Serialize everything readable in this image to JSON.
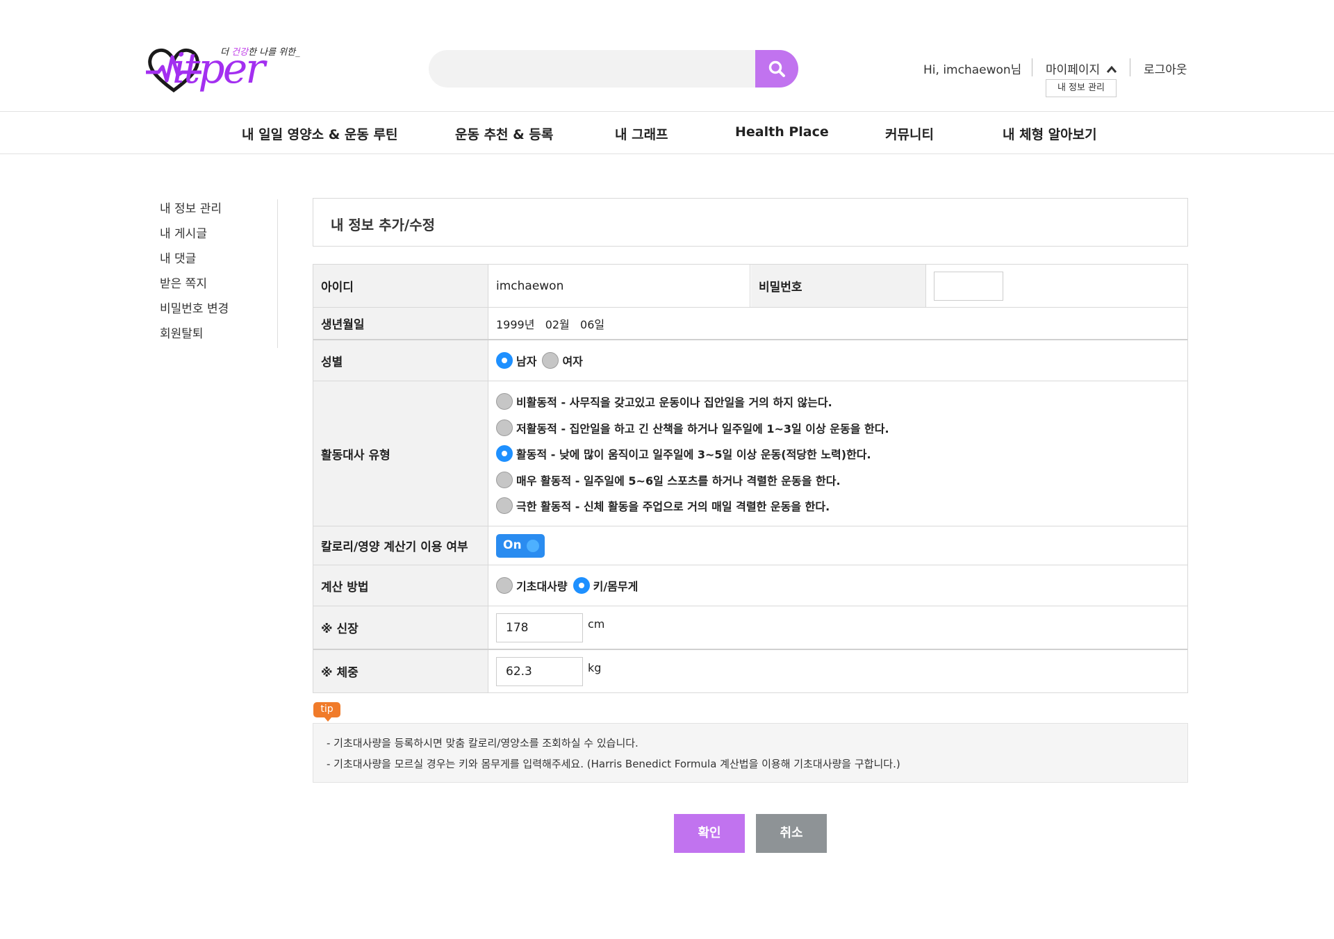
{
  "header": {
    "logo_tagline_pre": "더 ",
    "logo_tagline_accent": "건강",
    "logo_tagline_post": "한 나를 위한_",
    "logo_word": "itper",
    "search_placeholder": "",
    "greeting": "Hi, imchaewon님",
    "mypage": "마이페이지",
    "mypage_submenu": "내 정보 관리",
    "logout": "로그아웃"
  },
  "nav": [
    "내 일일 영양소 & 운동 루틴",
    "운동 추천 & 등록",
    "내 그래프",
    "Health Place",
    "커뮤니티",
    "내 체형 알아보기"
  ],
  "sidebar": [
    "내 정보 관리",
    "내 게시글",
    "내 댓글",
    "받은 쪽지",
    "비밀번호 변경",
    "회원탈퇴"
  ],
  "page_title": "내 정보 추가/수정",
  "form": {
    "id_label": "아이디",
    "id_value": "imchaewon",
    "password_label": "비밀번호",
    "password_value": "",
    "birth_label": "생년월일",
    "birth_value": "1999년   02월   06일",
    "gender_label": "성별",
    "gender_options": [
      "남자",
      "여자"
    ],
    "gender_selected": 0,
    "activity_label": "활동대사 유형",
    "activity_options": [
      "비활동적 - 사무직을 갖고있고 운동이나 집안일을 거의 하지 않는다.",
      "저활동적 - 집안일을 하고 긴 산책을 하거나 일주일에 1~3일 이상 운동을 한다.",
      "활동적 - 낮에 많이 움직이고 일주일에 3~5일 이상 운동(적당한 노력)한다.",
      "매우 활동적 - 일주일에 5~6일 스포츠를 하거나 격렬한 운동을 한다.",
      "극한 활동적 - 신체 활동을 주업으로 거의 매일 격렬한 운동을 한다."
    ],
    "activity_selected": 2,
    "calc_use_label": "칼로리/영양 계산기 이용 여부",
    "calc_use_toggle": "On",
    "method_label": "계산 방법",
    "method_options": [
      "기초대사량",
      "키/몸무게"
    ],
    "method_selected": 1,
    "height_label": "※ 신장",
    "height_value": "178",
    "height_unit": "cm",
    "weight_label": "※ 체중",
    "weight_value": "62.3",
    "weight_unit": "kg"
  },
  "tip": {
    "badge": "tip",
    "lines": [
      "- 기초대사량을 등록하시면 맞춤 칼로리/영양소를 조회하실 수 있습니다.",
      "- 기초대사량을 모르실 경우는 키와 몸무게를 입력해주세요. (Harris Benedict Formula 계산법을 이용해 기초대사량을 구합니다.)"
    ]
  },
  "buttons": {
    "confirm": "확인",
    "cancel": "취소"
  },
  "colors": {
    "brand": "#a32ff0",
    "search_button": "#c173ef",
    "confirm": "#c173ef",
    "cancel": "#8e9396",
    "radio_on": "#1e90ff",
    "toggle": "#2a8cf0",
    "tip_badge": "#f07b2a"
  },
  "icons": {
    "search": "search-icon",
    "chevron": "chevron-up-icon",
    "logo": "heartbeat-heart-icon"
  }
}
